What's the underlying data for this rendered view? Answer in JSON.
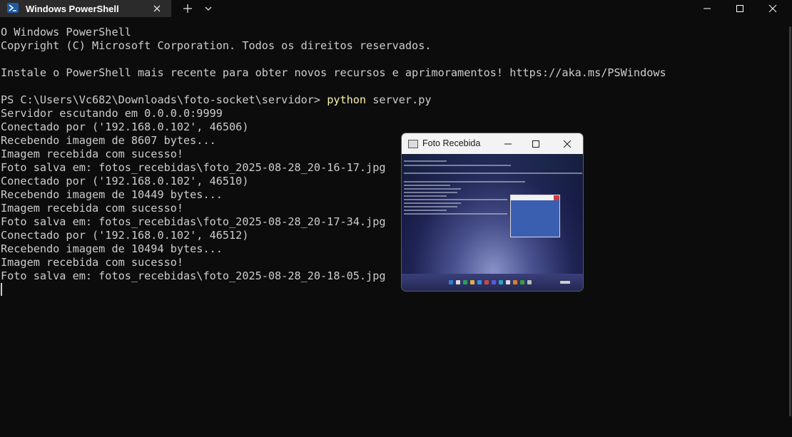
{
  "tab": {
    "title": "Windows PowerShell",
    "icon": "powershell-icon"
  },
  "window_controls": [
    "minimize",
    "maximize",
    "close"
  ],
  "terminal": {
    "lines": [
      {
        "text": "O Windows PowerShell"
      },
      {
        "text": "Copyright (C) Microsoft Corporation. Todos os direitos reservados."
      },
      {
        "text": ""
      },
      {
        "text": "Instale o PowerShell mais recente para obter novos recursos e aprimoramentos! https://aka.ms/PSWindows"
      },
      {
        "text": ""
      },
      {
        "prompt": "PS C:\\Users\\Vc682\\Downloads\\foto-socket\\servidor> ",
        "command": "python",
        "args": " server.py"
      },
      {
        "text": "Servidor escutando em 0.0.0.0:9999"
      },
      {
        "text": "Conectado por ('192.168.0.102', 46506)"
      },
      {
        "text": "Recebendo imagem de 8607 bytes..."
      },
      {
        "text": "Imagem recebida com sucesso!"
      },
      {
        "text": "Foto salva em: fotos_recebidas\\foto_2025-08-28_20-16-17.jpg"
      },
      {
        "text": "Conectado por ('192.168.0.102', 46510)"
      },
      {
        "text": "Recebendo imagem de 10449 bytes..."
      },
      {
        "text": "Imagem recebida com sucesso!"
      },
      {
        "text": "Foto salva em: fotos_recebidas\\foto_2025-08-28_20-17-34.jpg"
      },
      {
        "text": "Conectado por ('192.168.0.102', 46512)"
      },
      {
        "text": "Recebendo imagem de 10494 bytes..."
      },
      {
        "text": "Imagem recebida com sucesso!"
      },
      {
        "text": "Foto salva em: fotos_recebidas\\foto_2025-08-28_20-18-05.jpg"
      }
    ]
  },
  "image_window": {
    "title": "Foto Recebida"
  },
  "colors": {
    "background": "#0c0c0c",
    "text": "#cccccc",
    "command_highlight": "#f9f1a5",
    "tab_background": "#2b2b2b"
  }
}
